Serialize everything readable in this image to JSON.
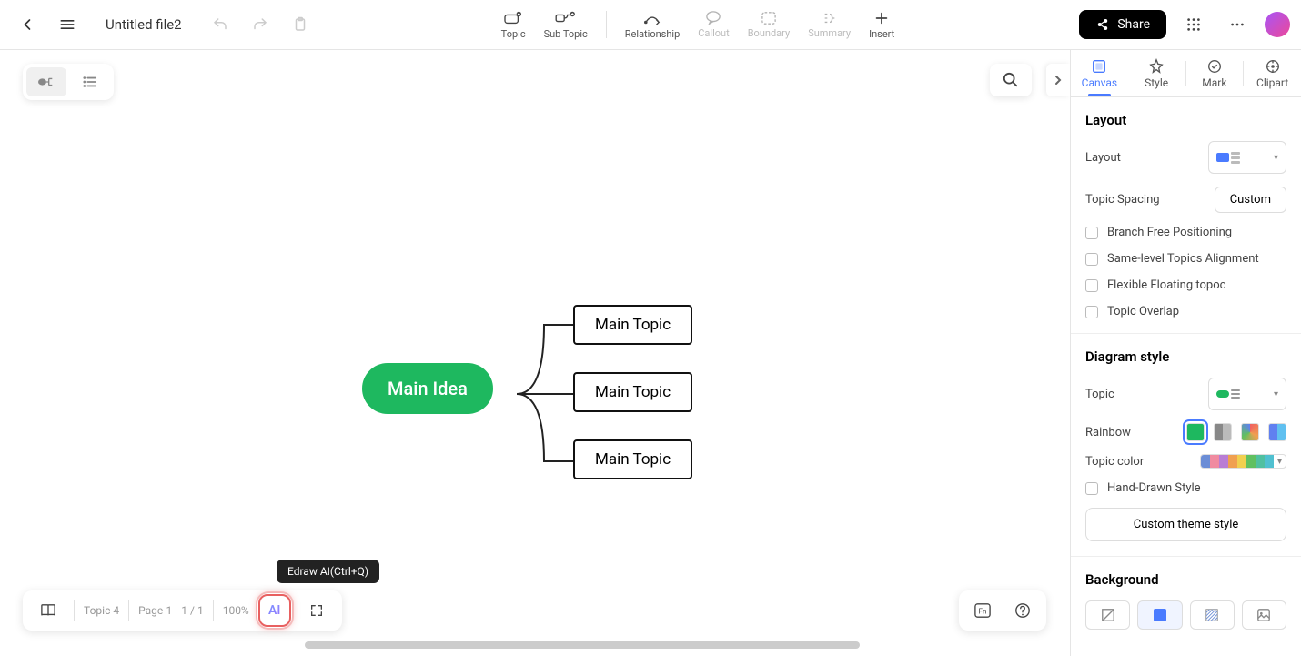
{
  "filename": "Untitled file2",
  "toolbar": {
    "topic": "Topic",
    "subtopic": "Sub Topic",
    "relationship": "Relationship",
    "callout": "Callout",
    "boundary": "Boundary",
    "summary": "Summary",
    "insert": "Insert"
  },
  "share_label": "Share",
  "mindmap": {
    "main_idea": "Main Idea",
    "topics": [
      "Main Topic",
      "Main Topic",
      "Main Topic"
    ]
  },
  "panel": {
    "tabs": {
      "canvas": "Canvas",
      "style": "Style",
      "mark": "Mark",
      "clipart": "Clipart"
    },
    "layout": {
      "title": "Layout",
      "layout_label": "Layout",
      "spacing_label": "Topic Spacing",
      "custom_btn": "Custom",
      "branch_free": "Branch Free Positioning",
      "same_level": "Same-level Topics Alignment",
      "flexible": "Flexible Floating topoc",
      "overlap": "Topic Overlap"
    },
    "diagram": {
      "title": "Diagram style",
      "topic_label": "Topic",
      "rainbow_label": "Rainbow",
      "color_label": "Topic color",
      "hand_drawn": "Hand-Drawn Style",
      "theme_btn": "Custom theme style"
    },
    "background": {
      "title": "Background"
    }
  },
  "bottom": {
    "topic_count": "Topic 4",
    "page": "Page-1",
    "page_pos": "1 / 1",
    "zoom": "100%",
    "ai_label": "AI",
    "tooltip": "Edraw AI(Ctrl+Q)"
  },
  "colors": {
    "primary": "#1eb85f",
    "accent": "#4a7bff",
    "palette": [
      "#6b8dd6",
      "#f08ba0",
      "#b97dd4",
      "#f0a050",
      "#f0d050",
      "#60c060",
      "#50c0a0",
      "#50c0d0"
    ]
  }
}
